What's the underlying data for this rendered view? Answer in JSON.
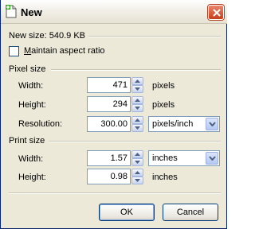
{
  "window": {
    "title": "New",
    "title_icon": "new-document-icon",
    "close_icon": "close-icon"
  },
  "new_size": "New size: 540.9 KB",
  "maintain_aspect": {
    "label_prefix": "",
    "label_underline": "M",
    "label_rest": "aintain aspect ratio",
    "checked": false
  },
  "pixel_size": {
    "group_label": "Pixel size",
    "width": {
      "label": "Width:",
      "value": "471",
      "unit": "pixels"
    },
    "height": {
      "label": "Height:",
      "value": "294",
      "unit": "pixels"
    },
    "resolution": {
      "label": "Resolution:",
      "value": "300.00",
      "unit": "pixels/inch"
    }
  },
  "print_size": {
    "group_label": "Print size",
    "width": {
      "label": "Width:",
      "value": "1.57",
      "unit": "inches"
    },
    "height": {
      "label": "Height:",
      "value": "0.98",
      "unit": "inches"
    }
  },
  "buttons": {
    "ok": "OK",
    "cancel": "Cancel"
  },
  "colors": {
    "dialog_bg": "#ece9d8",
    "input_border": "#7f9db9",
    "close_red": "#c43e1c"
  }
}
